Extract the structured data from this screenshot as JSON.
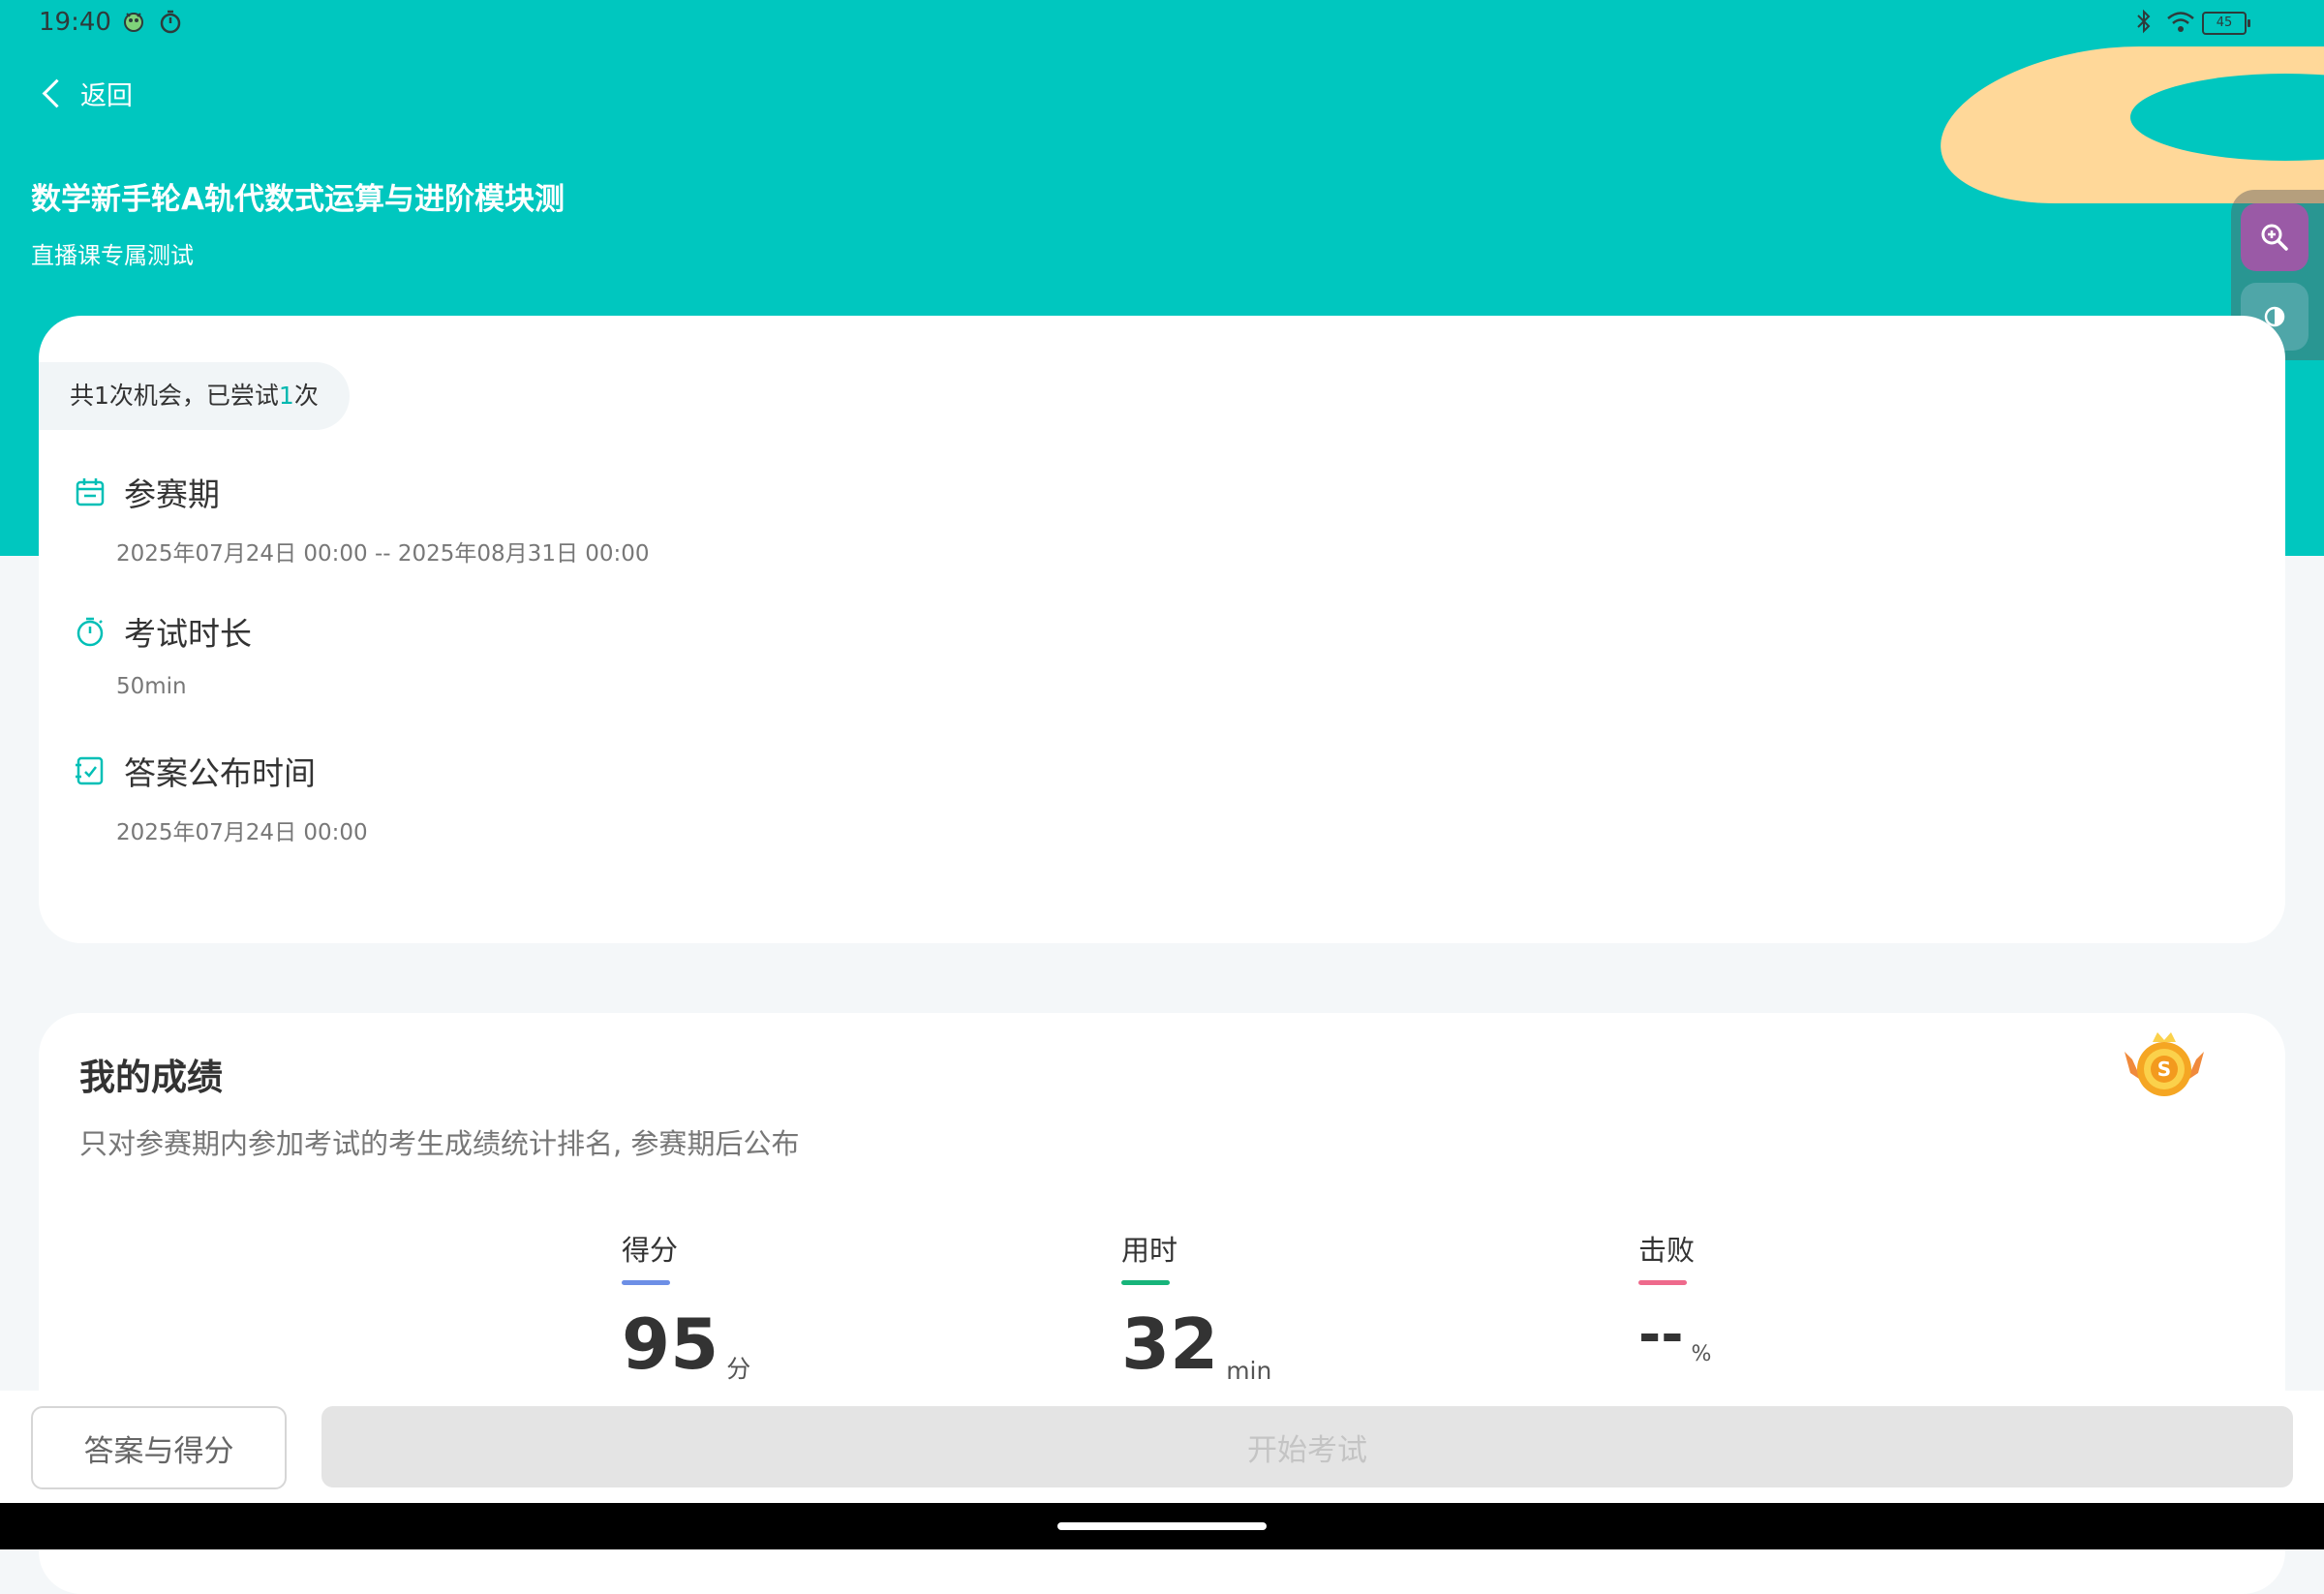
{
  "status_bar": {
    "time": "19:40",
    "battery": "45"
  },
  "header": {
    "back_label": "返回",
    "title": "数学新手轮A轨代数式运算与进阶模块测",
    "subtitle": "直播课专属测试"
  },
  "attempts": {
    "prefix": "共1次机会，已尝试",
    "count": "1",
    "suffix": "次"
  },
  "info": {
    "period_label": "参赛期",
    "period_value": "2025年07月24日 00:00  --  2025年08月31日 00:00",
    "duration_label": "考试时长",
    "duration_value": "50min",
    "answer_time_label": "答案公布时间",
    "answer_time_value": "2025年07月24日 00:00"
  },
  "result": {
    "title": "我的成绩",
    "note": "只对参赛期内参加考试的考生成绩统计排名, 参赛期后公布",
    "score_label": "得分",
    "score_value": "95",
    "score_unit": "分",
    "time_label": "用时",
    "time_value": "32",
    "time_unit": "min",
    "beat_label": "击败",
    "beat_value": "--",
    "beat_unit": "%"
  },
  "buttons": {
    "answers": "答案与得分",
    "start": "开始考试"
  },
  "colors": {
    "brand": "#00c7bf",
    "score_accent": "#6d8fe6",
    "time_accent": "#17b47a",
    "beat_accent": "#ee6a8c",
    "zoom_tool": "#9a5aa6",
    "contrast_tool": "#4fa6a8"
  }
}
